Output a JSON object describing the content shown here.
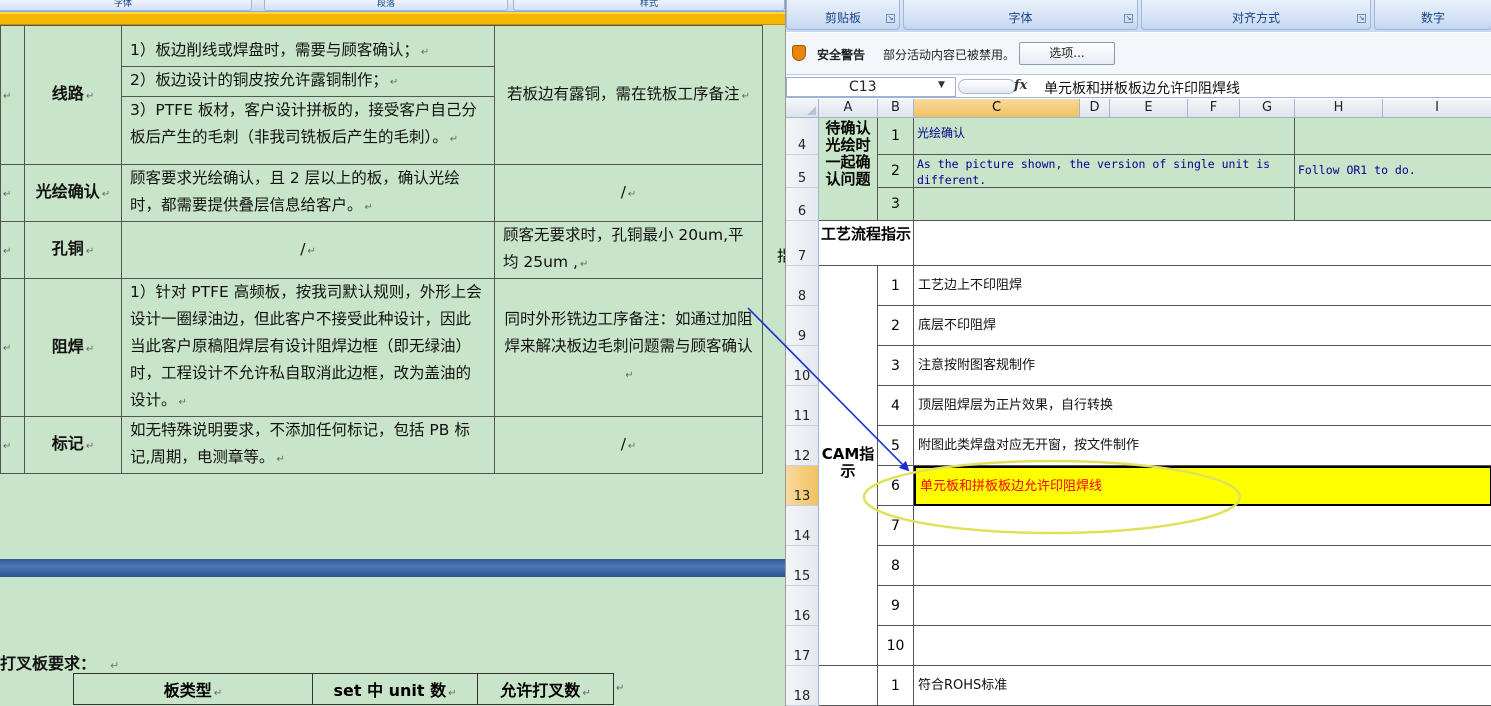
{
  "word": {
    "ribbon_groups": [
      "字体",
      "段落",
      "样式"
    ],
    "table": [
      {
        "label": "线路",
        "items": [
          "1）板边削线或焊盘时，需要与顾客确认；",
          "2）板边设计的铜皮按允许露铜制作；",
          "3）PTFE 板材，客户设计拼板的，接受客户自己分板后产生的毛刺（非我司铣板后产生的毛刺）。"
        ],
        "note": "若板边有露铜，需在铣板工序备注"
      },
      {
        "label": "光绘确认",
        "text": "顾客要求光绘确认，且 2 层以上的板，确认光绘时，都需要提供叠层信息给客户。",
        "note": "/"
      },
      {
        "label": "孔铜",
        "text": "/",
        "note": "顾客无要求时，孔铜最小 20um,平均 25um ,"
      },
      {
        "label": "阻焊",
        "text": "1）针对 PTFE 高频板，按我司默认规则，外形上会设计一圈绿油边，但此客户不接受此种设计，因此当此客户原稿阻焊层有设计阻焊边框（即无绿油）时，工程设计不允许私自取消此边框，改为盖油的设计。",
        "note": "同时外形铣边工序备注：如通过加阻焊来解决板边毛刺问题需与顾客确认"
      },
      {
        "label": "标记",
        "text": "如无特殊说明要求，不添加任何标记，包括 PB 标记,周期，电测章等。",
        "note": "/"
      }
    ],
    "right_glyph": "指",
    "caption": "打叉板要求：",
    "table2_headers": [
      "板类型",
      "set 中 unit 数",
      "允许打叉数"
    ]
  },
  "excel": {
    "ribbon_groups": [
      "剪贴板",
      "字体",
      "对齐方式",
      "数字"
    ],
    "security_title": "安全警告",
    "security_text": "部分活动内容已被禁用。",
    "security_button": "选项...",
    "name_box": "C13",
    "fx": "fx",
    "formula_value": "单元板和拼板板边允许印阻焊线",
    "columns": [
      "A",
      "B",
      "C",
      "D",
      "E",
      "F",
      "G",
      "H",
      "I"
    ],
    "selected_column": "C",
    "row_numbers": [
      "4",
      "5",
      "6",
      "7",
      "8",
      "9",
      "10",
      "11",
      "12",
      "13",
      "14",
      "15",
      "16",
      "17",
      "18"
    ],
    "selected_row": "13",
    "section1_title": "待确认光绘时一起确认问题",
    "section1_rows": [
      {
        "num": "1",
        "text": "光绘确认",
        "h": ""
      },
      {
        "num": "2",
        "text": "As the picture shown, the version of single unit is different.",
        "h": "Follow OR1 to do."
      },
      {
        "num": "3",
        "text": "",
        "h": ""
      }
    ],
    "section2_title": "工艺流程指示",
    "section3_title": "CAM指示",
    "cam_rows": [
      {
        "num": "1",
        "text": "工艺边上不印阻焊"
      },
      {
        "num": "2",
        "text": "底层不印阻焊"
      },
      {
        "num": "3",
        "text": "注意按附图客规制作"
      },
      {
        "num": "4",
        "text": "顶层阻焊层为正片效果，自行转换"
      },
      {
        "num": "5",
        "text": "附图此类焊盘对应无开窗，按文件制作"
      },
      {
        "num": "6",
        "text": "单元板和拼板板边允许印阻焊线"
      },
      {
        "num": "7",
        "text": ""
      },
      {
        "num": "8",
        "text": ""
      },
      {
        "num": "9",
        "text": ""
      },
      {
        "num": "10",
        "text": ""
      }
    ],
    "last_row": {
      "num": "1",
      "text": "符合ROHS标准"
    },
    "colors": {
      "highlight": "#ffff00",
      "highlight_text": "#ff0000",
      "annotation_ellipse": "#e8e85a",
      "arrow": "#1a2fd6"
    }
  }
}
